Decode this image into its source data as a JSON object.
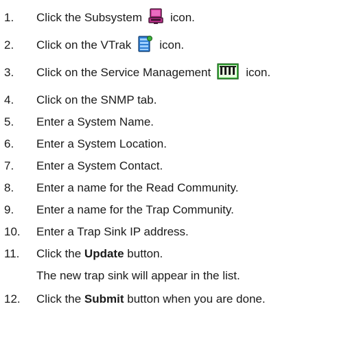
{
  "steps": [
    {
      "num": "1.",
      "pre": "Click the Subsystem",
      "icon": "subsystem-icon",
      "post": "icon."
    },
    {
      "num": "2.",
      "pre": "Click on the VTrak",
      "icon": "vtrak-icon",
      "post": "icon."
    },
    {
      "num": "3.",
      "pre": "Click on the Service Management",
      "icon": "service-management-icon",
      "post": "icon."
    },
    {
      "num": "4.",
      "text": "Click on the SNMP tab."
    },
    {
      "num": "5.",
      "text": "Enter a System Name."
    },
    {
      "num": "6.",
      "text": "Enter a System Location."
    },
    {
      "num": "7.",
      "text": "Enter a System Contact."
    },
    {
      "num": "8.",
      "text": "Enter a name for the Read Community."
    },
    {
      "num": "9.",
      "text": "Enter a name for the Trap Community."
    },
    {
      "num": "10.",
      "text": "Enter a Trap Sink IP address."
    },
    {
      "num": "11.",
      "pre": "Click the",
      "bold": "Update",
      "post": "button."
    },
    {
      "num": "12.",
      "pre": "Click the",
      "bold": "Submit",
      "post": "button when you are done."
    }
  ],
  "note_after_step_11": "The new trap sink will appear in the list.",
  "colors": {
    "text": "#1a1a1a",
    "subsystem_icon": "#d63ea0",
    "vtrak_icon": "#2f7fd3",
    "service_icon": "#3ab23a"
  }
}
